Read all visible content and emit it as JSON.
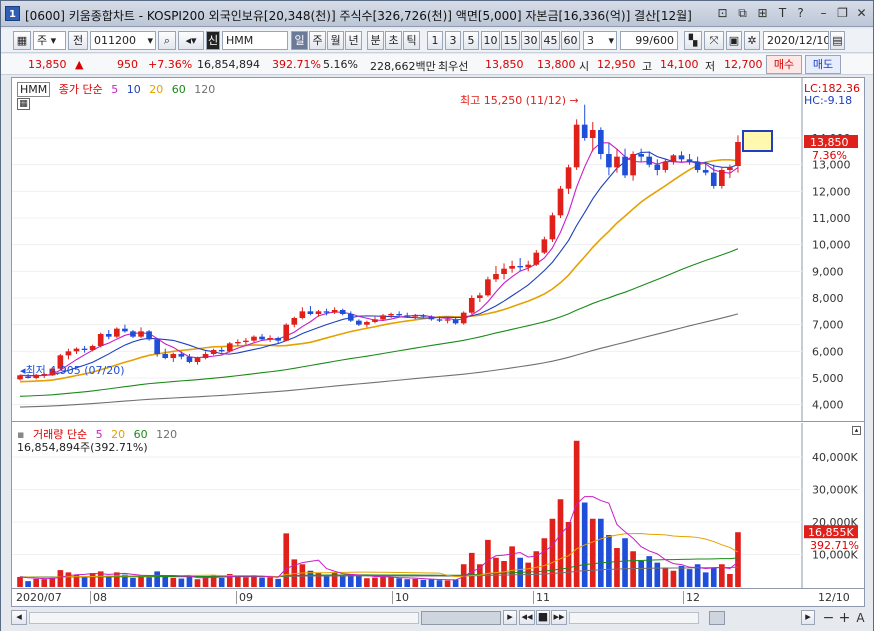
{
  "title": {
    "text": "[0600] 키움종합차트 - KOSPI200 외국인보유[20,348(천)] 주식수[326,726(천)] 액면[5,000] 자본금[16,336(억)] 결산[12월]"
  },
  "toolbar": {
    "period_label": "주",
    "prev_label": "전",
    "code": "011200",
    "stock_name": "HMM",
    "credit_badge": "신",
    "period_buttons": [
      "일",
      "주",
      "월",
      "년",
      "분",
      "초",
      "틱"
    ],
    "selected_period": "일",
    "interval_buttons": [
      "1",
      "3",
      "5",
      "10",
      "15",
      "30",
      "45",
      "60"
    ],
    "interval_select": "3",
    "count": "99/600",
    "date": "2020/12/10"
  },
  "quote": {
    "price": "13,850",
    "arrow": "▲",
    "change": "950",
    "change_pct": "+7.36%",
    "volume": "16,854,894",
    "volume_pct": "392.71%",
    "turnover": "5.16%",
    "amount": "228,662백만",
    "priority_label": "최우선",
    "ask": "13,850",
    "bid": "13,800",
    "open_label": "시",
    "open": "12,950",
    "high_label": "고",
    "high": "14,100",
    "low_label": "저",
    "low": "12,700",
    "buy_label": "매수",
    "sell_label": "매도"
  },
  "price_legend": {
    "name": "HMM",
    "close_label": "종가 단순",
    "ma": [
      "5",
      "10",
      "20",
      "60",
      "120"
    ]
  },
  "price_axis": {
    "lc": "LC:182.36",
    "hc": "HC:-9.18",
    "current": "13,850",
    "current_pct": "7.36%",
    "ticks": [
      "14,000",
      "13,000",
      "12,000",
      "11,000",
      "10,000",
      "9,000",
      "8,000",
      "7,000",
      "6,000",
      "5,000",
      "4,000"
    ]
  },
  "annotations": {
    "high": "최고 15,250 (11/12)",
    "low": "최저 4,905 (07/20)"
  },
  "volume_legend": {
    "label": "거래량 단순",
    "ma": [
      "5",
      "20",
      "60",
      "120"
    ],
    "value": "16,854,894주(392.71%)"
  },
  "volume_axis": {
    "ticks": [
      "40,000K",
      "30,000K",
      "20,000K",
      "10,000K"
    ],
    "current": "16,855K",
    "current_pct": "392.71%"
  },
  "x_axis": {
    "labels": [
      "2020/07",
      "08",
      "09",
      "10",
      "11",
      "12"
    ],
    "right_label": "12/10"
  },
  "colors": {
    "up": "#e0201b",
    "down": "#1f4fd8",
    "ma5": "#c81ec8",
    "ma10": "#1f3fbf",
    "ma20": "#e6a000",
    "ma60": "#1a8a1a",
    "ma120": "#707070"
  },
  "chart_data": {
    "type": "candlestick",
    "price_range": [
      3500,
      15800
    ],
    "volume_range": [
      0,
      48000
    ],
    "candles": [
      [
        4950,
        5130,
        4905,
        5100,
        3100
      ],
      [
        5050,
        5150,
        4980,
        5000,
        1800
      ],
      [
        5000,
        5150,
        4950,
        5120,
        2500
      ],
      [
        5100,
        5200,
        5000,
        5150,
        2400
      ],
      [
        5100,
        5400,
        5080,
        5350,
        3000
      ],
      [
        5350,
        5900,
        5300,
        5850,
        5200
      ],
      [
        5850,
        6100,
        5700,
        6000,
        4500
      ],
      [
        6000,
        6150,
        5900,
        6100,
        3800
      ],
      [
        6100,
        6200,
        5950,
        6050,
        3000
      ],
      [
        6050,
        6250,
        6000,
        6200,
        4300
      ],
      [
        6200,
        6700,
        6150,
        6650,
        4800
      ],
      [
        6650,
        6800,
        6450,
        6550,
        3500
      ],
      [
        6550,
        6900,
        6500,
        6850,
        4500
      ],
      [
        6850,
        7000,
        6700,
        6750,
        3800
      ],
      [
        6750,
        6800,
        6500,
        6550,
        2800
      ],
      [
        6550,
        6900,
        6500,
        6750,
        3500
      ],
      [
        6750,
        6800,
        6400,
        6450,
        3000
      ],
      [
        6450,
        6500,
        5800,
        5900,
        4800
      ],
      [
        5900,
        6100,
        5700,
        5750,
        3500
      ],
      [
        5750,
        5950,
        5600,
        5900,
        2800
      ],
      [
        5900,
        6000,
        5700,
        5800,
        2600
      ],
      [
        5800,
        5900,
        5550,
        5600,
        3200
      ],
      [
        5600,
        5800,
        5500,
        5750,
        2400
      ],
      [
        5750,
        6000,
        5700,
        5900,
        3100
      ],
      [
        5900,
        6100,
        5850,
        6050,
        3600
      ],
      [
        6050,
        6150,
        5950,
        6000,
        2800
      ],
      [
        6000,
        6350,
        5950,
        6300,
        4000
      ],
      [
        6300,
        6450,
        6200,
        6350,
        3300
      ],
      [
        6350,
        6500,
        6250,
        6400,
        3000
      ],
      [
        6400,
        6600,
        6350,
        6550,
        3600
      ],
      [
        6550,
        6650,
        6400,
        6450,
        2900
      ],
      [
        6450,
        6600,
        6350,
        6500,
        3000
      ],
      [
        6500,
        6550,
        6300,
        6400,
        2500
      ],
      [
        6400,
        7050,
        6380,
        7000,
        16500
      ],
      [
        7000,
        7300,
        6900,
        7250,
        8500
      ],
      [
        7250,
        7650,
        7200,
        7500,
        7000
      ],
      [
        7500,
        7700,
        7350,
        7400,
        5000
      ],
      [
        7400,
        7550,
        7300,
        7500,
        4300
      ],
      [
        7500,
        7600,
        7350,
        7450,
        3600
      ],
      [
        7450,
        7650,
        7400,
        7550,
        4300
      ],
      [
        7550,
        7600,
        7350,
        7400,
        3400
      ],
      [
        7400,
        7500,
        7100,
        7150,
        3800
      ],
      [
        7150,
        7200,
        6950,
        7000,
        3400
      ],
      [
        7000,
        7150,
        6900,
        7100,
        2700
      ],
      [
        7100,
        7300,
        7050,
        7200,
        2900
      ],
      [
        7200,
        7400,
        7150,
        7350,
        3100
      ],
      [
        7350,
        7450,
        7250,
        7400,
        3000
      ],
      [
        7400,
        7500,
        7300,
        7350,
        2700
      ],
      [
        7350,
        7450,
        7250,
        7300,
        2400
      ],
      [
        7300,
        7400,
        7200,
        7350,
        2500
      ],
      [
        7350,
        7400,
        7250,
        7300,
        2200
      ],
      [
        7300,
        7350,
        7150,
        7200,
        2300
      ],
      [
        7200,
        7300,
        7100,
        7150,
        2100
      ],
      [
        7150,
        7250,
        7050,
        7200,
        2000
      ],
      [
        7200,
        7250,
        7000,
        7050,
        2300
      ],
      [
        7050,
        7500,
        7000,
        7450,
        7000
      ],
      [
        7450,
        8100,
        7400,
        8000,
        10500
      ],
      [
        8000,
        8200,
        7850,
        8100,
        7000
      ],
      [
        8100,
        8800,
        8050,
        8700,
        14500
      ],
      [
        8700,
        9200,
        8600,
        8900,
        9000
      ],
      [
        8900,
        9300,
        8700,
        9100,
        8000
      ],
      [
        9100,
        9400,
        8950,
        9200,
        12500
      ],
      [
        9200,
        9500,
        9000,
        9150,
        9000
      ],
      [
        9150,
        9400,
        9000,
        9250,
        7500
      ],
      [
        9250,
        9800,
        9200,
        9700,
        11000
      ],
      [
        9700,
        10300,
        9650,
        10200,
        15000
      ],
      [
        10200,
        11200,
        10100,
        11100,
        21000
      ],
      [
        11100,
        12200,
        11000,
        12100,
        27000
      ],
      [
        12100,
        13000,
        11900,
        12900,
        20000
      ],
      [
        12900,
        14700,
        12800,
        14500,
        45000
      ],
      [
        14500,
        15250,
        13900,
        14000,
        26000
      ],
      [
        14000,
        14600,
        13500,
        14300,
        21000
      ],
      [
        14300,
        14400,
        13200,
        13400,
        21000
      ],
      [
        13400,
        13800,
        12600,
        12900,
        16000
      ],
      [
        12900,
        13600,
        12700,
        13300,
        12000
      ],
      [
        13300,
        13600,
        12500,
        12600,
        15000
      ],
      [
        12600,
        13500,
        12400,
        13400,
        11000
      ],
      [
        13400,
        13600,
        13100,
        13300,
        8000
      ],
      [
        13300,
        13500,
        12900,
        13000,
        9500
      ],
      [
        13000,
        13200,
        12600,
        12800,
        7500
      ],
      [
        12800,
        13200,
        12700,
        13100,
        6000
      ],
      [
        13100,
        13400,
        13000,
        13350,
        5000
      ],
      [
        13350,
        13500,
        13100,
        13200,
        6500
      ],
      [
        13200,
        13400,
        13000,
        13100,
        5500
      ],
      [
        13100,
        13300,
        12700,
        12800,
        7000
      ],
      [
        12800,
        13100,
        12600,
        12700,
        4500
      ],
      [
        12700,
        13000,
        12100,
        12200,
        6000
      ],
      [
        12200,
        12900,
        12100,
        12800,
        7000
      ],
      [
        12800,
        13000,
        12500,
        12900,
        4000
      ],
      [
        12950,
        14100,
        12700,
        13850,
        16855
      ]
    ]
  }
}
